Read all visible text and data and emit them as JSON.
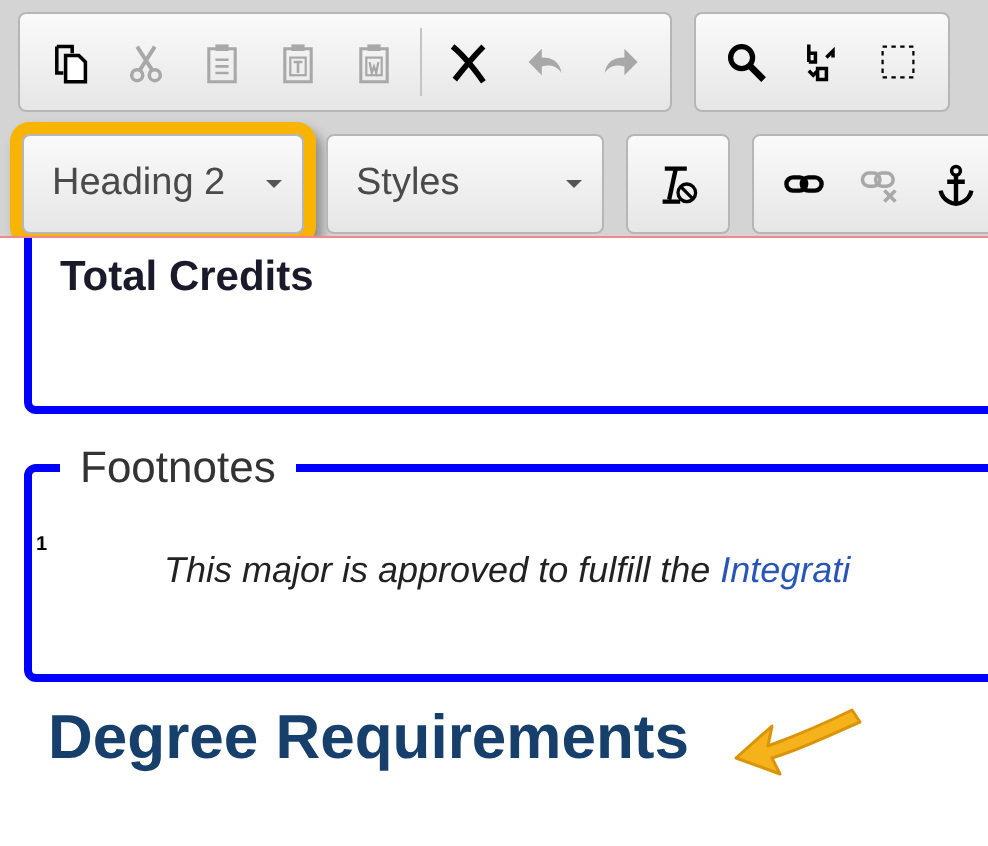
{
  "toolbar": {
    "rows": [
      {
        "items": [
          {
            "kind": "group",
            "buttons": [
              {
                "kind": "copy",
                "disabled": false
              },
              {
                "kind": "cut",
                "disabled": true
              },
              {
                "kind": "paste",
                "disabled": true
              },
              {
                "kind": "paste-text",
                "disabled": true
              },
              {
                "kind": "paste-word",
                "disabled": true
              },
              {
                "kind": "separator"
              },
              {
                "kind": "remove-format",
                "disabled": false
              },
              {
                "kind": "undo",
                "disabled": true
              },
              {
                "kind": "redo",
                "disabled": true
              }
            ]
          },
          {
            "kind": "group",
            "buttons": [
              {
                "kind": "search",
                "disabled": false
              },
              {
                "kind": "replace",
                "disabled": false
              },
              {
                "kind": "select-all",
                "disabled": false
              }
            ]
          }
        ]
      },
      {
        "items": [
          {
            "kind": "dropdown",
            "label": "Heading 2",
            "highlighted": true
          },
          {
            "kind": "dropdown",
            "label": "Styles",
            "highlighted": false
          },
          {
            "kind": "group",
            "buttons": [
              {
                "kind": "clear-style",
                "disabled": false
              }
            ]
          },
          {
            "kind": "group",
            "buttons": [
              {
                "kind": "link",
                "disabled": false
              },
              {
                "kind": "unlink",
                "disabled": true
              },
              {
                "kind": "anchor",
                "disabled": false
              }
            ]
          }
        ]
      }
    ]
  },
  "content": {
    "credits_title": "Total Credits",
    "footnotes": {
      "legend": "Footnotes",
      "items": [
        {
          "mark": "1",
          "text": "This major is approved to fulfill the ",
          "link": "Integrati"
        }
      ]
    },
    "heading": "Degree Requirements",
    "heading_pointed": true
  }
}
